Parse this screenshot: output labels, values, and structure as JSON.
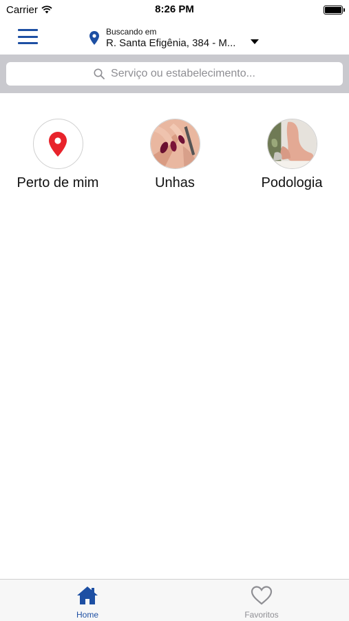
{
  "status_bar": {
    "carrier": "Carrier",
    "time": "8:26 PM"
  },
  "header": {
    "location_caption": "Buscando em",
    "location_address": "R. Santa Efigênia, 384 - M..."
  },
  "search": {
    "placeholder": "Serviço ou estabelecimento..."
  },
  "categories": [
    {
      "label": "Perto de mim",
      "icon": "location-pin-icon"
    },
    {
      "label": "Unhas",
      "icon": "nails-photo"
    },
    {
      "label": "Podologia",
      "icon": "feet-photo"
    }
  ],
  "tab_bar": {
    "home_label": "Home",
    "favorites_label": "Favoritos"
  },
  "colors": {
    "brand_blue": "#1d4fa3",
    "pin_red": "#e8232b",
    "inactive_gray": "#8e8e93"
  }
}
